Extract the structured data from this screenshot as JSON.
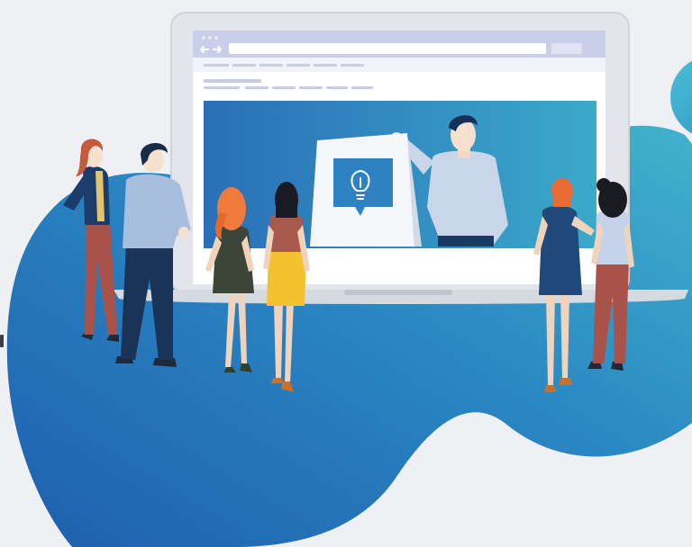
{
  "scene": {
    "kind": "illustration",
    "icons": [
      "lightbulb-icon",
      "back-arrow-icon",
      "forward-arrow-icon"
    ]
  },
  "colors": {
    "background": "#eef0f4",
    "blob_dark": "#1f63ad",
    "blob_light": "#3fb0cc",
    "screen_gradient_start": "#2a6fb8",
    "screen_gradient_end": "#3ba9c9",
    "laptop_frame": "#e2e5ea",
    "browser_bar": "#c9cfe8",
    "sign_panel": "#ffffff",
    "sign_icon": "#2e82c2"
  }
}
